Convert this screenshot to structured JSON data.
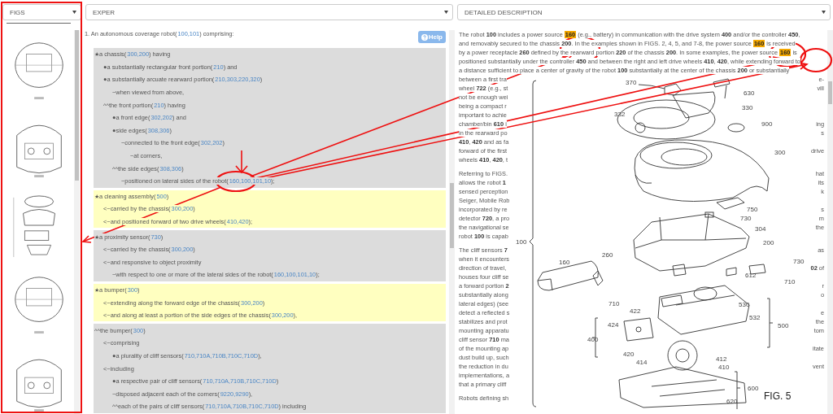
{
  "selectors": [
    {
      "label": "FIGS"
    },
    {
      "label": "EXPER"
    },
    {
      "label": "DETAILED DESCRIPTION"
    }
  ],
  "claims": {
    "help_button": "Help",
    "heading": {
      "text": "1. An autonomous coverage robot(",
      "ref": "100,101",
      "after": ") comprising:"
    },
    "groups": [
      {
        "highlighted": false,
        "rows": [
          {
            "text": "★a chassis(",
            "ref": "300,200",
            "after": ") having",
            "children": [
              {
                "text": "●a substantially rectangular front portion(",
                "ref": "210",
                "after": ") and"
              },
              {
                "text": "●a substantially arcuate rearward portion(",
                "ref": "210,303,220,320",
                "after": ")",
                "children": [
                  {
                    "text": "~when viewed from above,"
                  }
                ]
              },
              {
                "text": "^^the front portion(",
                "ref": "210",
                "after": ") having",
                "children": [
                  {
                    "text": "●a front edge(",
                    "ref": "302,202",
                    "after": ") and"
                  },
                  {
                    "text": "●side edges(",
                    "ref": "308,306",
                    "after": ")",
                    "children": [
                      {
                        "text": "~connected to the front edge(",
                        "ref": "302,202",
                        "after": ")",
                        "children": [
                          {
                            "text": "~at corners,"
                          }
                        ]
                      }
                    ]
                  },
                  {
                    "text": "^^the side edges(",
                    "ref": "308,306",
                    "after": ")",
                    "children": [
                      {
                        "text": "~positioned on lateral sides of the robot(",
                        "ref": "160,100,101,10",
                        "after": ");"
                      }
                    ]
                  }
                ]
              }
            ]
          }
        ]
      },
      {
        "highlighted": true,
        "rows": [
          {
            "text": "★a cleaning assembly(",
            "ref": "500",
            "after": ")",
            "children": [
              {
                "text": "<~carried by the chassis(",
                "ref": "300,200",
                "after": ")"
              },
              {
                "text": "<~and positioned forward of two drive wheels(",
                "ref": "410,420",
                "after": ");"
              }
            ]
          }
        ]
      },
      {
        "highlighted": false,
        "rows": [
          {
            "text": "★a proximity sensor(",
            "ref": "730",
            "after": ")",
            "children": [
              {
                "text": "<~carried by the chassis(",
                "ref": "300,200",
                "after": ")"
              },
              {
                "text": "<~and responsive to object proximity",
                "children": [
                  {
                    "text": "~with respect to one or more of the lateral sides of the robot(",
                    "ref": "160,100,101,10",
                    "after": ");"
                  }
                ]
              }
            ]
          }
        ]
      },
      {
        "highlighted": true,
        "rows": [
          {
            "text": "★a bumper(",
            "ref": "300",
            "after": ")",
            "children": [
              {
                "text": "<~extending along the forward edge of the chassis(",
                "ref": "300,200",
                "after": ")"
              },
              {
                "text": "<~and along at least a portion of the side edges of the chassis(",
                "ref": "300,200",
                "after": "),"
              }
            ]
          }
        ]
      },
      {
        "highlighted": false,
        "rows": [
          {
            "text": "^^the bumper(",
            "ref": "300",
            "after": ")",
            "children": [
              {
                "text": "<~comprising",
                "children": [
                  {
                    "text": "●a plurality of cliff sensors(",
                    "ref": "710,710A,710B,710C,710D",
                    "after": "),"
                  }
                ]
              },
              {
                "text": "<~including",
                "children": [
                  {
                    "text": "●a respective pair of cliff sensors(",
                    "ref": "710,710A,710B,710C,710D",
                    "after": ")"
                  },
                  {
                    "text": "~disposed adjacent each of the corners(",
                    "ref": "9220,9290",
                    "after": "),"
                  },
                  {
                    "text": "^^each of the pairs of cliff sensors(",
                    "ref": "710,710A,710B,710C,710D",
                    "after": ") including"
                  }
                ]
              }
            ]
          }
        ]
      }
    ]
  },
  "description": {
    "paragraphs": [
      {
        "lines": [
          {
            "parts": [
              {
                "text": "The robot **100** includes a power source ",
                "highlight": false
              },
              {
                "text": "160",
                "highlight": true
              },
              {
                "text": " (e.g., battery) in communication with the drive system **400** and/or the controller **450**,",
                "highlight": false
              }
            ]
          },
          {
            "parts": [
              {
                "text": "and removably secured to the chassis **200**. In the examples shown in FIGS. 2, 4, 5, and 7-8, the power source ",
                "highlight": false
              },
              {
                "text": "160",
                "highlight": true
              },
              {
                "text": " is received",
                "highlight": false
              }
            ]
          },
          {
            "parts": [
              {
                "text": "by a power receptacle **260** defined by the rearward portion **220** of the chassis **200**. In some examples, the power source ",
                "highlight": false
              },
              {
                "text": "160",
                "highlight": true
              },
              {
                "text": " is",
                "highlight": false
              }
            ]
          },
          {
            "parts": [
              {
                "text": "positioned substantially under the controller **450** and between the right and left drive wheels **410**, **420**, while extending forward to",
                "highlight": false
              }
            ]
          },
          {
            "parts": [
              {
                "text": "a distance sufficient to place a center of gravity of the robot **100** substantially at the center of the chassis **200** or substantially",
                "highlight": false
              }
            ]
          },
          {
            "parts": [
              {
                "text": "between a first tra",
                "highlight": false
              }
            ],
            "right": "e-"
          },
          {
            "parts": [
              {
                "text": "wheel **722** (e.g., st",
                "highlight": false
              }
            ],
            "right": "vill"
          },
          {
            "parts": [
              {
                "text": "not be enough wei",
                "highlight": false
              }
            ]
          },
          {
            "parts": [
              {
                "text": "being a compact r",
                "highlight": false
              }
            ]
          },
          {
            "parts": [
              {
                "text": "important to achie",
                "highlight": false
              }
            ]
          },
          {
            "parts": [
              {
                "text": "chamber/bin **610** i",
                "highlight": false
              }
            ],
            "right": "ing"
          },
          {
            "parts": [
              {
                "text": "in the rearward po",
                "highlight": false
              }
            ],
            "right": "s"
          },
          {
            "parts": [
              {
                "text": "**410**, **420** and as fa",
                "highlight": false
              }
            ]
          },
          {
            "parts": [
              {
                "text": "forward of the first",
                "highlight": false
              }
            ],
            "right": "drive"
          },
          {
            "parts": [
              {
                "text": "wheels **410**, **420**, t",
                "highlight": false
              }
            ]
          }
        ]
      },
      {
        "lines": [
          {
            "parts": [
              {
                "text": "Referring to FIGS.",
                "highlight": false
              }
            ],
            "right": "hat"
          },
          {
            "parts": [
              {
                "text": "allows the robot **1**",
                "highlight": false
              }
            ],
            "right": "its"
          },
          {
            "parts": [
              {
                "text": "sensed perception",
                "highlight": false
              }
            ],
            "right": "k"
          },
          {
            "parts": [
              {
                "text": "Seiger, Mobile Rob",
                "highlight": false
              }
            ]
          },
          {
            "parts": [
              {
                "text": "incorporated by re",
                "highlight": false
              }
            ],
            "right": "s"
          },
          {
            "parts": [
              {
                "text": "detector **720**, a pro",
                "highlight": false
              }
            ],
            "right": "m"
          },
          {
            "parts": [
              {
                "text": "the navigational se",
                "highlight": false
              }
            ],
            "right": "the"
          },
          {
            "parts": [
              {
                "text": "robot **100** is capab",
                "highlight": false
              }
            ]
          }
        ]
      },
      {
        "lines": [
          {
            "parts": [
              {
                "text": "The cliff sensors **7**",
                "highlight": false
              }
            ],
            "right": "as"
          },
          {
            "parts": [
              {
                "text": "when it encounters",
                "highlight": false
              }
            ]
          },
          {
            "parts": [
              {
                "text": "direction of travel,",
                "highlight": false
              }
            ],
            "right": "**02** of"
          },
          {
            "parts": [
              {
                "text": "houses four cliff se",
                "highlight": false
              }
            ]
          },
          {
            "parts": [
              {
                "text": "a forward portion **2**",
                "highlight": false
              }
            ],
            "right": "r"
          },
          {
            "parts": [
              {
                "text": "substantially along",
                "highlight": false
              }
            ],
            "right": "o"
          },
          {
            "parts": [
              {
                "text": "lateral edges) (see",
                "highlight": false
              }
            ]
          },
          {
            "parts": [
              {
                "text": "detect a reflected s",
                "highlight": false
              }
            ],
            "right": "e"
          },
          {
            "parts": [
              {
                "text": "stabilizes and prot",
                "highlight": false
              }
            ],
            "right": "the"
          },
          {
            "parts": [
              {
                "text": "mounting apparatu",
                "highlight": false
              }
            ],
            "right": "tom"
          },
          {
            "parts": [
              {
                "text": "cliff sensor **710** ma",
                "highlight": false
              }
            ]
          },
          {
            "parts": [
              {
                "text": "of the mounting ap",
                "highlight": false
              }
            ],
            "right": "itate"
          },
          {
            "parts": [
              {
                "text": "dust build up, such",
                "highlight": false
              }
            ]
          },
          {
            "parts": [
              {
                "text": "the reduction in du",
                "highlight": false
              }
            ],
            "right": "vent"
          },
          {
            "parts": [
              {
                "text": "implementations, a",
                "highlight": false
              }
            ]
          },
          {
            "parts": [
              {
                "text": "that a primary cliff",
                "highlight": false
              }
            ]
          }
        ]
      },
      {
        "lines": [
          {
            "parts": [
              {
                "text": "Robots defining sh",
                "highlight": false
              }
            ]
          }
        ]
      }
    ],
    "figure": {
      "title": "FIG. 5",
      "callouts": [
        "370",
        "630",
        "330",
        "332",
        "900",
        "300",
        "750",
        "730",
        "304",
        "200",
        "260",
        "730",
        "160",
        "612",
        "710",
        "710",
        "530",
        "532",
        "422",
        "424",
        "500",
        "400",
        "420",
        "412",
        "414",
        "410",
        "600",
        "620",
        "100"
      ]
    }
  }
}
